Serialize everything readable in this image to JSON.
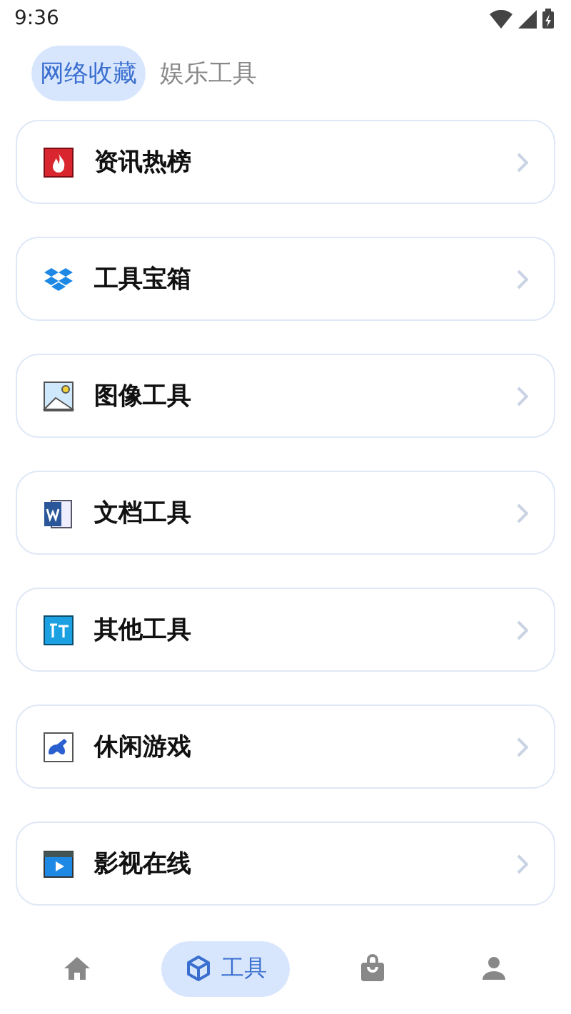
{
  "status_bar": {
    "time": "9:36"
  },
  "tabs": [
    {
      "label": "网络收藏",
      "selected": true
    },
    {
      "label": "娱乐工具",
      "selected": false
    }
  ],
  "items": [
    {
      "label": "资讯热榜",
      "kind": "fire"
    },
    {
      "label": "工具宝箱",
      "kind": "box"
    },
    {
      "label": "图像工具",
      "kind": "image"
    },
    {
      "label": "文档工具",
      "kind": "doc"
    },
    {
      "label": "其他工具",
      "kind": "text"
    },
    {
      "label": "休闲游戏",
      "kind": "game"
    },
    {
      "label": "影视在线",
      "kind": "video"
    }
  ],
  "bottom_nav": [
    {
      "kind": "home",
      "selected": false
    },
    {
      "kind": "tools",
      "label": "工具",
      "selected": true
    },
    {
      "kind": "bag",
      "selected": false
    },
    {
      "kind": "user",
      "selected": false
    }
  ]
}
